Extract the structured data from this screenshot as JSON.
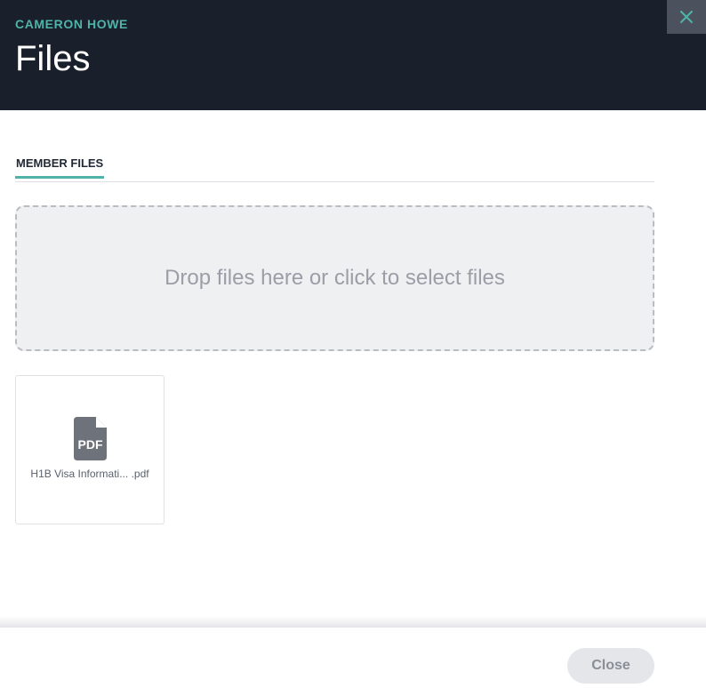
{
  "header": {
    "subtitle": "CAMERON HOWE",
    "title": "Files",
    "close_icon": "close-icon"
  },
  "tabs": [
    {
      "label": "MEMBER FILES",
      "active": true
    }
  ],
  "dropzone": {
    "text": "Drop files here or click to select files"
  },
  "files": [
    {
      "name": "H1B Visa Informati... .pdf",
      "icon": "pdf-file-icon",
      "icon_text": "PDF"
    }
  ],
  "footer": {
    "close_label": "Close"
  },
  "colors": {
    "header_bg": "#1a202b",
    "accent": "#4fb3aa",
    "dropzone_bg": "#eff0f2",
    "icon_gray": "#6e727a"
  }
}
